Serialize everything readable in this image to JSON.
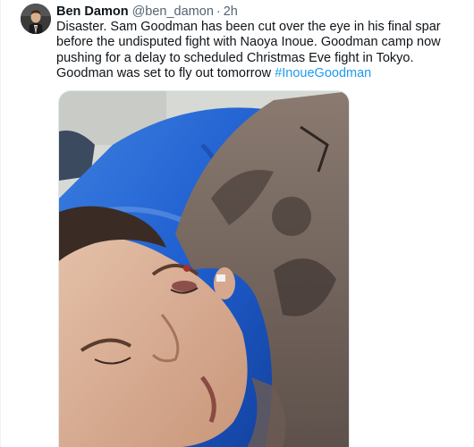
{
  "tweet": {
    "display_name": "Ben Damon",
    "handle": "@ben_damon",
    "separator": "·",
    "time": "2h",
    "text_main": "Disaster. Sam Goodman has been cut over the eye in his final spar before the undisputed fight with Naoya Inoue. Goodman camp now pushing for a delay to scheduled Christmas Eve fight in Tokyo. Goodman was set to fly out tomorrow",
    "hashtag": "#InoueGoodman"
  },
  "colors": {
    "text": "#0f1419",
    "secondary": "#536471",
    "link": "#1d9bf0",
    "pillow": "#1f5fd0"
  }
}
